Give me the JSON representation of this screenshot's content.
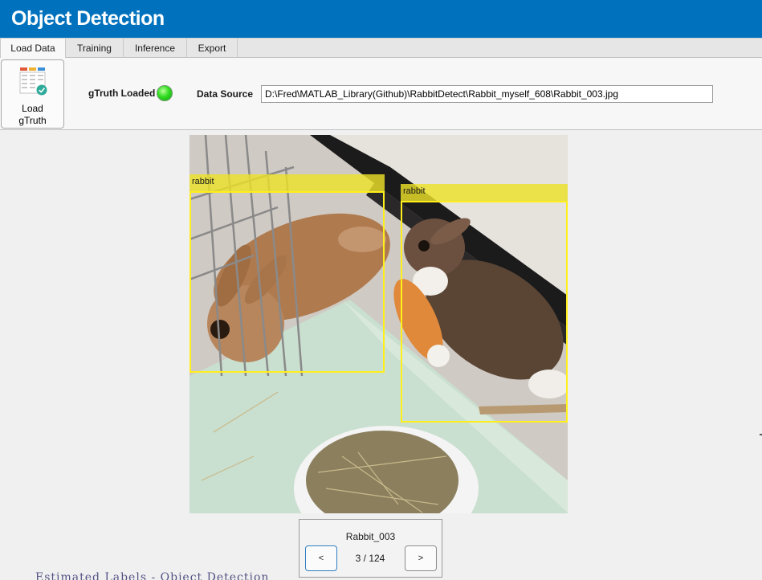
{
  "window": {
    "title": "Object Detection"
  },
  "tabs": [
    {
      "label": "Load Data",
      "active": true
    },
    {
      "label": "Training",
      "active": false
    },
    {
      "label": "Inference",
      "active": false
    },
    {
      "label": "Export",
      "active": false
    }
  ],
  "toolbar": {
    "load_button": {
      "line1": "Load",
      "line2": "gTruth",
      "icon": "table-check-icon"
    },
    "gtruth_label": "gTruth Loaded",
    "gtruth_status_color": "#33dd22",
    "data_source_label": "Data Source",
    "data_source_value": "D:\\Fred\\MATLAB_Library(Github)\\RabbitDetect\\Rabbit_myself_608\\Rabbit_003.jpg"
  },
  "viewer": {
    "detections": [
      {
        "label": "rabbit"
      },
      {
        "label": "rabbit"
      }
    ],
    "box_color": "#ffef1a"
  },
  "navigator": {
    "image_name": "Rabbit_003",
    "position_text": "3 / 124",
    "prev_label": "<",
    "next_label": ">"
  },
  "footer": {
    "partial_text": "Estimated Labels - Object Detection"
  }
}
